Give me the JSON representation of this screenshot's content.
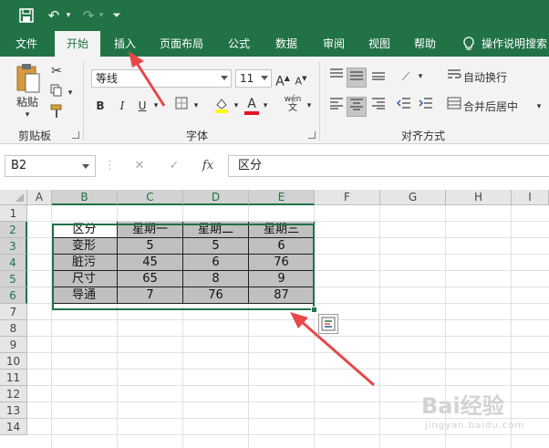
{
  "quick_access": {
    "save_icon": "save-icon",
    "undo_icon": "undo-icon",
    "redo_icon": "redo-icon",
    "customize_icon": "customize-icon"
  },
  "tabs": [
    {
      "label": "文件"
    },
    {
      "label": "开始"
    },
    {
      "label": "插入"
    },
    {
      "label": "页面布局"
    },
    {
      "label": "公式"
    },
    {
      "label": "数据"
    },
    {
      "label": "审阅"
    },
    {
      "label": "视图"
    },
    {
      "label": "帮助"
    },
    {
      "label": "操作说明搜索"
    }
  ],
  "ribbon": {
    "clipboard": {
      "paste_label": "粘贴",
      "group_label": "剪贴板"
    },
    "font": {
      "font_name": "等线",
      "font_size": "11",
      "grow_label": "A",
      "shrink_label": "A",
      "bold": "B",
      "italic": "I",
      "underline": "U",
      "font_color_label": "A",
      "phonetic_label": "wén",
      "group_label": "字体"
    },
    "alignment": {
      "wrap_text": "自动换行",
      "merge_center": "合并后居中",
      "group_label": "对齐方式"
    }
  },
  "formula_bar": {
    "name_box": "B2",
    "fx_label": "fx",
    "formula": "区分"
  },
  "grid": {
    "columns": [
      "A",
      "B",
      "C",
      "D",
      "E",
      "F",
      "G",
      "H",
      "I"
    ],
    "rows": [
      "1",
      "2",
      "3",
      "4",
      "5",
      "6",
      "7",
      "8",
      "9",
      "10",
      "11",
      "12",
      "13",
      "14"
    ],
    "table": [
      [
        "区分",
        "星期一",
        "星期二",
        "星期三"
      ],
      [
        "变形",
        "5",
        "5",
        "6"
      ],
      [
        "脏污",
        "45",
        "6",
        "76"
      ],
      [
        "尺寸",
        "65",
        "8",
        "9"
      ],
      [
        "导通",
        "7",
        "76",
        "87"
      ]
    ]
  },
  "colors": {
    "brand": "#217346",
    "annotation_arrow": "#e8474a",
    "cell_fill": "#c0c0c0"
  },
  "watermark": {
    "text": "Bai经验",
    "sub": "jingyan.baidu.com"
  }
}
